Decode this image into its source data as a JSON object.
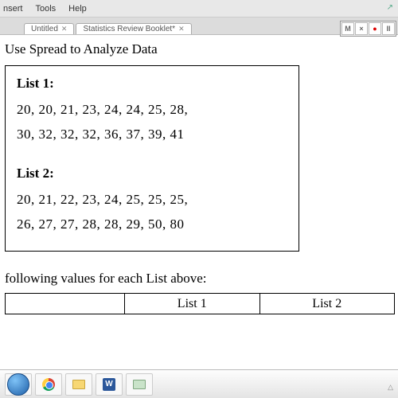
{
  "menu": {
    "items": [
      "nsert",
      "Tools",
      "Help"
    ]
  },
  "tabs": [
    {
      "label": "Untitled",
      "close": "✕"
    },
    {
      "label": "Statistics Review Booklet*",
      "close": "✕"
    }
  ],
  "tools_right": {
    "m": "M",
    "x": "×",
    "rec": "●",
    "ii": "II"
  },
  "title": "Use Spread to Analyze Data",
  "list1": {
    "label": "List 1:",
    "row1": "20,  20,  21,  23,  24,  24,  25,  28,",
    "row2": "30,  32,  32,  32,  36,  37,   39,   41"
  },
  "list2": {
    "label": "List 2:",
    "row1": "20,  21,  22,  23,  24,  25,  25,  25,",
    "row2": "26,  27,  27,  28,  28,  29,  50,  80"
  },
  "prompt": "following values for each List above:",
  "table": {
    "h1": "List 1",
    "h2": "List 2"
  },
  "task_word": "W",
  "tray": "△"
}
